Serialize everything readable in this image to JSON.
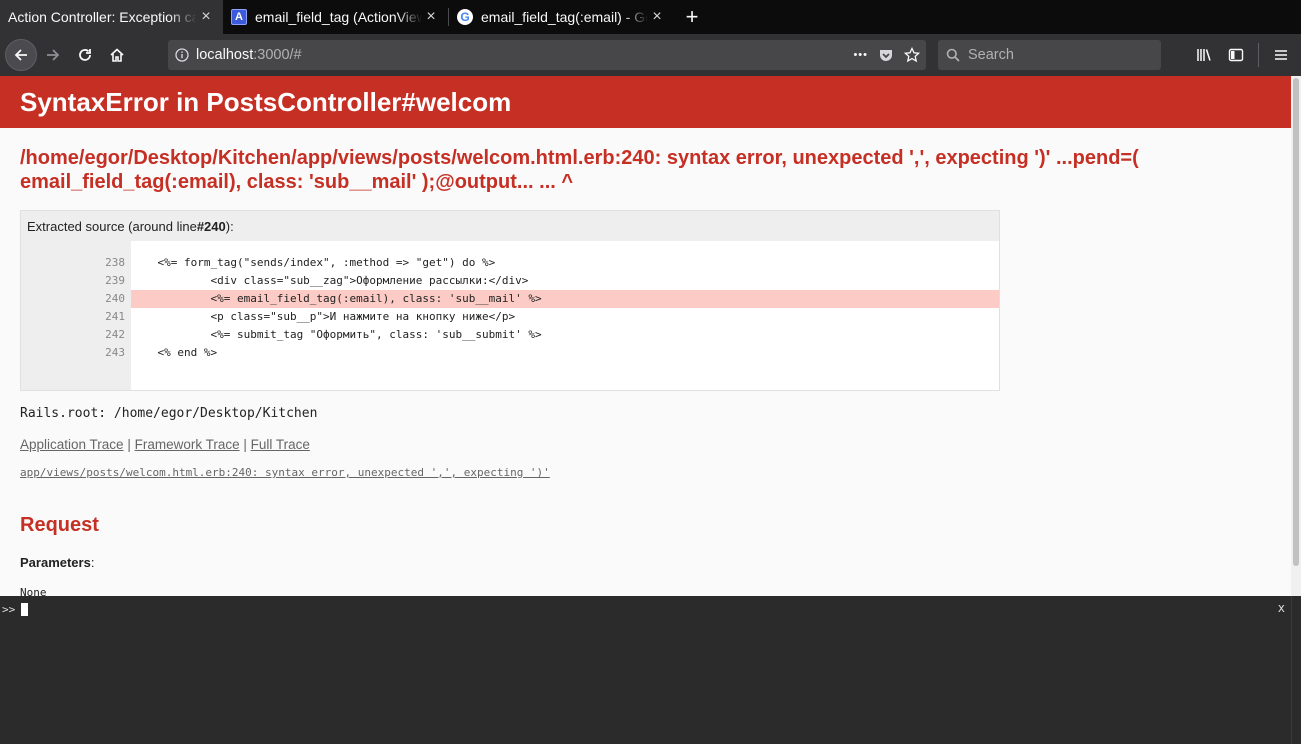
{
  "browser": {
    "tabs": [
      {
        "title": "Action Controller: Exception caught",
        "active": true
      },
      {
        "title": "email_field_tag (ActionView::Helpers)",
        "active": false
      },
      {
        "title": "email_field_tag(:email) - Google",
        "active": false
      }
    ],
    "close_glyph": "×",
    "new_tab_glyph": "+",
    "url_host": "localhost",
    "url_rest": ":3000/#",
    "search_placeholder": "Search",
    "page_actions_glyph": "•••"
  },
  "page": {
    "header_title": "SyntaxError in PostsController#welcom",
    "error_message": "/home/egor/Desktop/Kitchen/app/views/posts/welcom.html.erb:240: syntax error, unexpected ',', expecting ')' ...pend=( email_field_tag(:email), class: 'sub__mail' );@output... ... ^",
    "extracted_source_prefix": "Extracted source (around line ",
    "extracted_source_line": "#240",
    "extracted_source_suffix": "):",
    "source_lines": [
      {
        "num": "238",
        "code": "    <%= form_tag(\"sends/index\", :method => \"get\") do %>",
        "highlight": false
      },
      {
        "num": "239",
        "code": "            <div class=\"sub__zag\">Оформление рассылки:</div>",
        "highlight": false
      },
      {
        "num": "240",
        "code": "            <%= email_field_tag(:email), class: 'sub__mail' %>",
        "highlight": true
      },
      {
        "num": "241",
        "code": "            <p class=\"sub__p\">И нажмите на кнопку ниже</p>",
        "highlight": false
      },
      {
        "num": "242",
        "code": "            <%= submit_tag \"Оформить\", class: 'sub__submit' %>",
        "highlight": false
      },
      {
        "num": "243",
        "code": "    <% end %>",
        "highlight": false
      }
    ],
    "rails_root": "Rails.root: /home/egor/Desktop/Kitchen",
    "trace_links": {
      "application": "Application Trace",
      "framework": "Framework Trace",
      "full": "Full Trace",
      "separator": " | "
    },
    "trace_line": "app/views/posts/welcom.html.erb:240: syntax error, unexpected ',', expecting ')'",
    "request_title": "Request",
    "parameters_label": "Parameters",
    "parameters_colon": ":",
    "parameters_value": "None"
  },
  "console": {
    "prompt": ">>",
    "close": "x"
  },
  "colors": {
    "accent_red": "#c52f24",
    "highlight_line": "#fccbc6"
  }
}
